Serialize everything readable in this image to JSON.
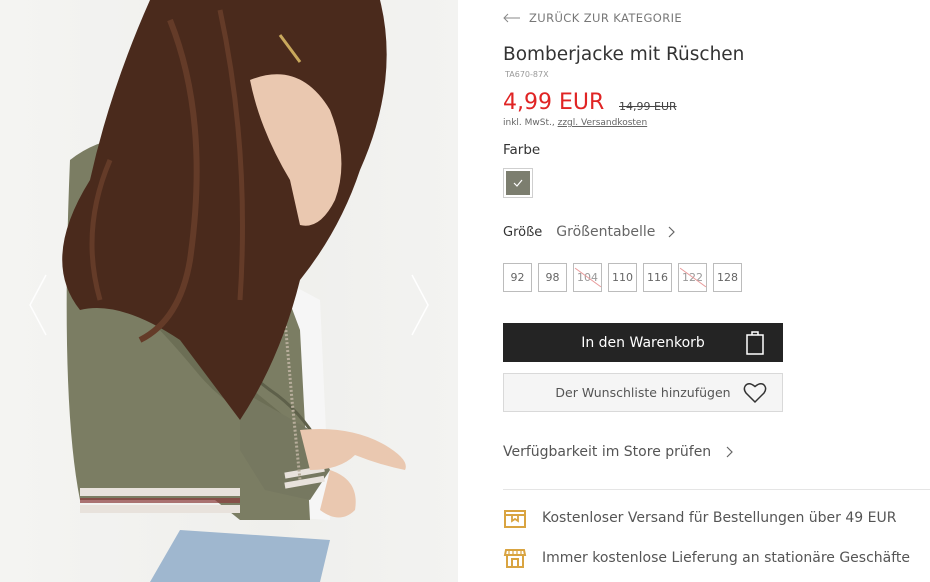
{
  "navigation": {
    "back_label": "ZURÜCK ZUR KATEGORIE"
  },
  "product": {
    "title": "Bomberjacke mit Rüschen",
    "sku": "TA670-87X",
    "price": "4,99 EUR",
    "old_price": "14,99 EUR",
    "tax_prefix": "inkl. MwSt.,",
    "shipping_link": "zzgl. Versandkosten"
  },
  "colors": {
    "label": "Farbe",
    "options": [
      {
        "name": "olive",
        "hex": "#7c7e6f",
        "selected": true
      }
    ]
  },
  "size": {
    "label": "Größe",
    "table_link": "Größentabelle",
    "options": [
      {
        "label": "92",
        "available": true
      },
      {
        "label": "98",
        "available": true
      },
      {
        "label": "104",
        "available": false
      },
      {
        "label": "110",
        "available": true
      },
      {
        "label": "116",
        "available": true
      },
      {
        "label": "122",
        "available": false
      },
      {
        "label": "128",
        "available": true
      }
    ]
  },
  "actions": {
    "add_to_cart": "In den Warenkorb",
    "add_to_wishlist": "Der Wunschliste hinzufügen",
    "store_availability": "Verfügbarkeit im Store prüfen"
  },
  "benefits": [
    {
      "icon": "delivery-box-icon",
      "text": "Kostenloser Versand für Bestellungen über 49 EUR"
    },
    {
      "icon": "store-icon",
      "text": "Immer kostenlose Lieferung an stationäre Geschäfte"
    }
  ],
  "theme": {
    "accent_price": "#e02424",
    "icon_gold": "#d9a441",
    "button_dark": "#242424"
  },
  "gallery": {
    "prev_icon": "chevron-left-icon",
    "next_icon": "chevron-right-icon"
  }
}
